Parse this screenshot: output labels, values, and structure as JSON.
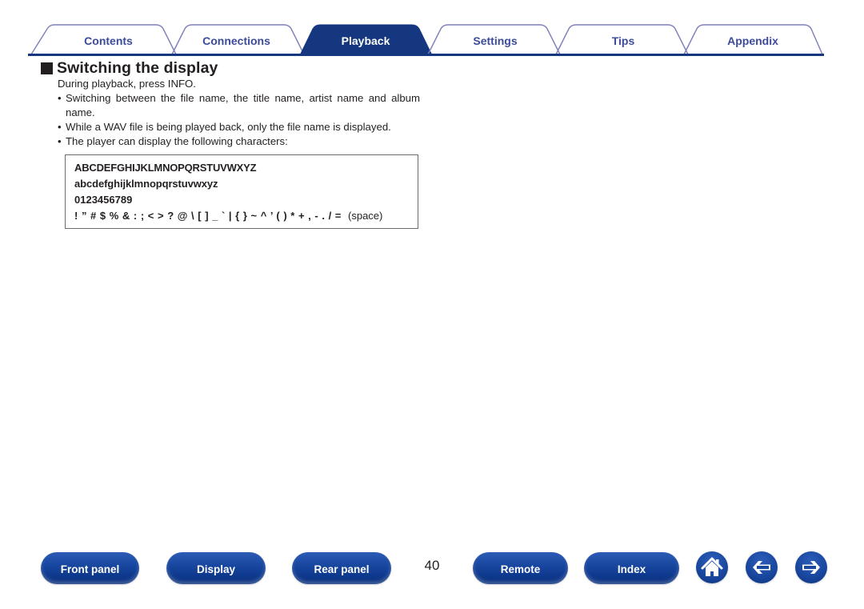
{
  "tabs": [
    {
      "label": "Contents",
      "active": false
    },
    {
      "label": "Connections",
      "active": false
    },
    {
      "label": "Playback",
      "active": true
    },
    {
      "label": "Settings",
      "active": false
    },
    {
      "label": "Tips",
      "active": false
    },
    {
      "label": "Appendix",
      "active": false
    }
  ],
  "colors": {
    "tab_active_fill": "#14377f",
    "tab_outline": "#7d7fb8",
    "tab_text": "#3c4c9a",
    "rule": "#14377f",
    "button_blue": "#1b4aa3"
  },
  "section": {
    "title": "Switching the display",
    "intro": "During playback, press INFO.",
    "bullets": [
      "Switching between the file name, the title name, artist name and album name.",
      "While a WAV file is being played back, only the file name is displayed.",
      "The player can display the following characters:"
    ],
    "characters": {
      "uppercase": "ABCDEFGHIJKLMNOPQRSTUVWXYZ",
      "lowercase": "abcdefghijklmnopqrstuvwxyz",
      "digits": "0123456789",
      "symbols": "! ” # $ % & : ; < > ? @ \\ [ ] _ ` | { } ~ ^ ’ ( ) * + , - . / =",
      "space_note": "(space)"
    }
  },
  "footer": {
    "buttons": [
      "Front panel",
      "Display",
      "Rear panel",
      "Remote",
      "Index"
    ],
    "page_number": "40",
    "icons": {
      "home": "home-icon",
      "back": "arrow-left-icon",
      "forward": "arrow-right-icon"
    }
  }
}
